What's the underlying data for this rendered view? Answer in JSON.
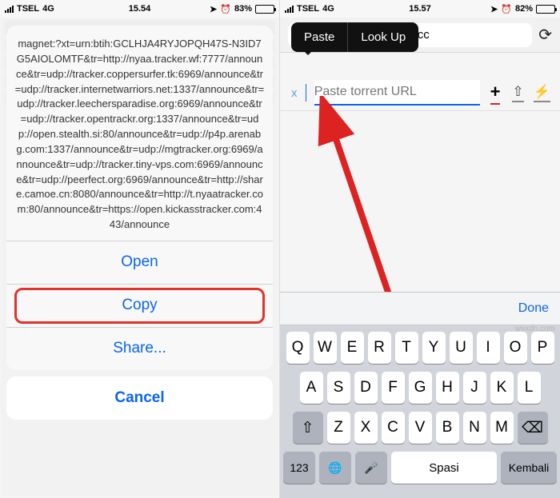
{
  "left": {
    "status": {
      "carrier": "TSEL",
      "net": "4G",
      "time": "15.54",
      "battery": "83%"
    },
    "magnet": "magnet:?xt=urn:btih:GCLHJA4RYJOPQH47S-N3ID7G5AIOLOMTF&tr=http://nyaa.tracker.wf:7777/announce&tr=udp://tracker.coppersurfer.tk:6969/announce&tr=udp://tracker.internetwarriors.net:1337/announce&tr=udp://tracker.leechersparadise.org:6969/announce&tr=udp://tracker.opentrackr.org:1337/announce&tr=udp://open.stealth.si:80/announce&tr=udp://p4p.arenabg.com:1337/announce&tr=udp://mgtracker.org:6969/announce&tr=udp://tracker.tiny-vps.com:6969/announce&tr=udp://peerfect.org:6969/announce&tr=http://share.camoe.cn:8080/announce&tr=http://t.nyaatracker.com:80/announce&tr=https://open.kickasstracker.com:443/announce",
    "actions": {
      "open": "Open",
      "copy": "Copy",
      "share": "Share...",
      "cancel": "Cancel"
    }
  },
  "right": {
    "status": {
      "carrier": "TSEL",
      "net": "4G",
      "time": "15.57",
      "battery": "82%"
    },
    "url_display": "eedr.cc",
    "tooltip": {
      "paste": "Paste",
      "lookup": "Look Up"
    },
    "input": {
      "clear": "x",
      "placeholder": "Paste torrent URL"
    },
    "toolbar": {
      "done": "Done"
    },
    "keyboard": {
      "row1": [
        "Q",
        "W",
        "E",
        "R",
        "T",
        "Y",
        "U",
        "I",
        "O",
        "P"
      ],
      "row2": [
        "A",
        "S",
        "D",
        "F",
        "G",
        "H",
        "J",
        "K",
        "L"
      ],
      "row3": [
        "Z",
        "X",
        "C",
        "V",
        "B",
        "N",
        "M"
      ],
      "num": "123",
      "space": "Spasi",
      "return": "Kembali"
    }
  },
  "watermark": "wsxdn.com"
}
